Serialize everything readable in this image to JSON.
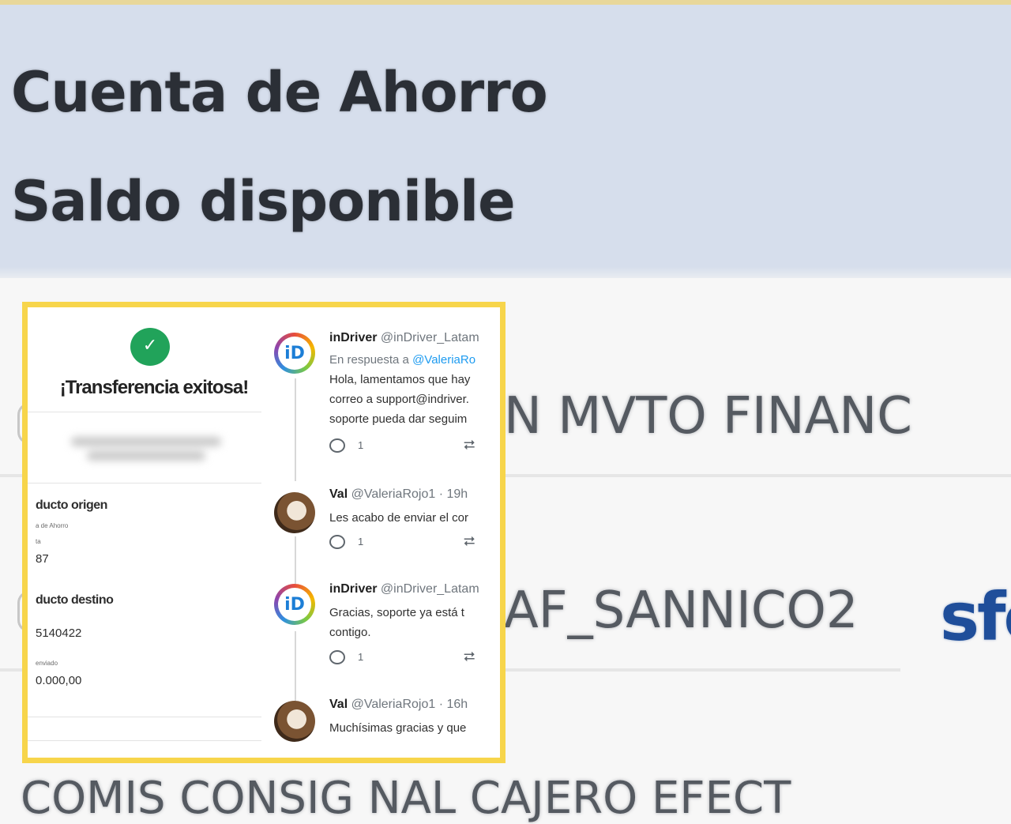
{
  "header": {
    "account_title": "Cuenta de Ahorro",
    "balance_label": "Saldo disponible"
  },
  "background_rows": [
    {
      "text": "N MVTO FINANC"
    },
    {
      "text": "AF_SANNICO2"
    },
    {
      "text": "COMIS CONSIG NAL CAJERO EFECT"
    }
  ],
  "logo_text": "sfc",
  "receipt": {
    "success_title": "¡Transferencia exitosa!",
    "origin_label": "ducto origen",
    "origin_type": "a de Ahorro",
    "origin_small": "ta",
    "origin_value": "87",
    "dest_label": "ducto destino",
    "dest_value": "5140422",
    "amount_small": "enviado",
    "amount_value": "0.000,00"
  },
  "thread": [
    {
      "name": "inDriver",
      "handle": "@inDriver_Latam",
      "reply_prefix": "En respuesta a",
      "reply_mention": "@ValeriaRo",
      "lines": [
        "Hola, lamentamos que hay",
        "correo a support@indriver.",
        "soporte pueda dar seguim"
      ],
      "reply_count": "1"
    },
    {
      "name": "Val",
      "handle": "@ValeriaRojo1 · 19h",
      "lines": [
        "Les acabo de enviar el cor"
      ],
      "reply_count": "1"
    },
    {
      "name": "inDriver",
      "handle": "@inDriver_Latam",
      "lines": [
        "Gracias, soporte ya está t",
        "contigo."
      ],
      "reply_count": "1"
    },
    {
      "name": "Val",
      "handle": "@ValeriaRojo1 · 16h",
      "lines": [
        "Muchísimas gracias y que"
      ]
    }
  ],
  "brand_avatar_letters": "iD",
  "colors": {
    "highlight_border": "#f7d54b",
    "success_green": "#21a35a",
    "mention_blue": "#1d9bf0",
    "header_band": "#d6deec"
  }
}
